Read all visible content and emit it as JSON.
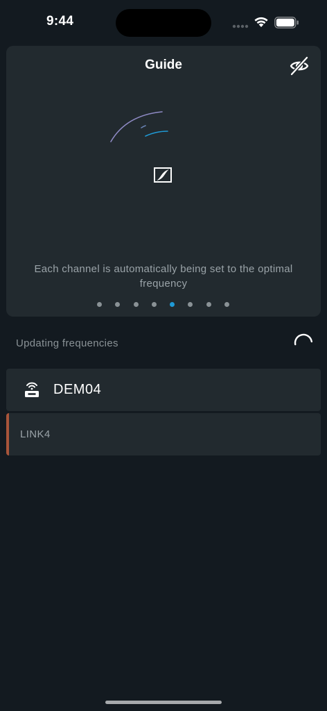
{
  "status_bar": {
    "time": "9:44"
  },
  "guide": {
    "title": "Guide",
    "description": "Each channel is automatically being set to the optimal frequency",
    "page_count": 8,
    "active_page": 5,
    "hide_icon": "eye-slash-icon",
    "logo_icon": "brand-logo-icon",
    "accent_color": "#1f9ad6"
  },
  "status": {
    "updating_label": "Updating frequencies",
    "spinner_icon": "spinner-icon"
  },
  "devices": [
    {
      "name": "DEM04",
      "icon": "receiver-lock-icon"
    }
  ],
  "links": [
    {
      "name": "LINK4",
      "accent_color": "#a8553a"
    }
  ]
}
